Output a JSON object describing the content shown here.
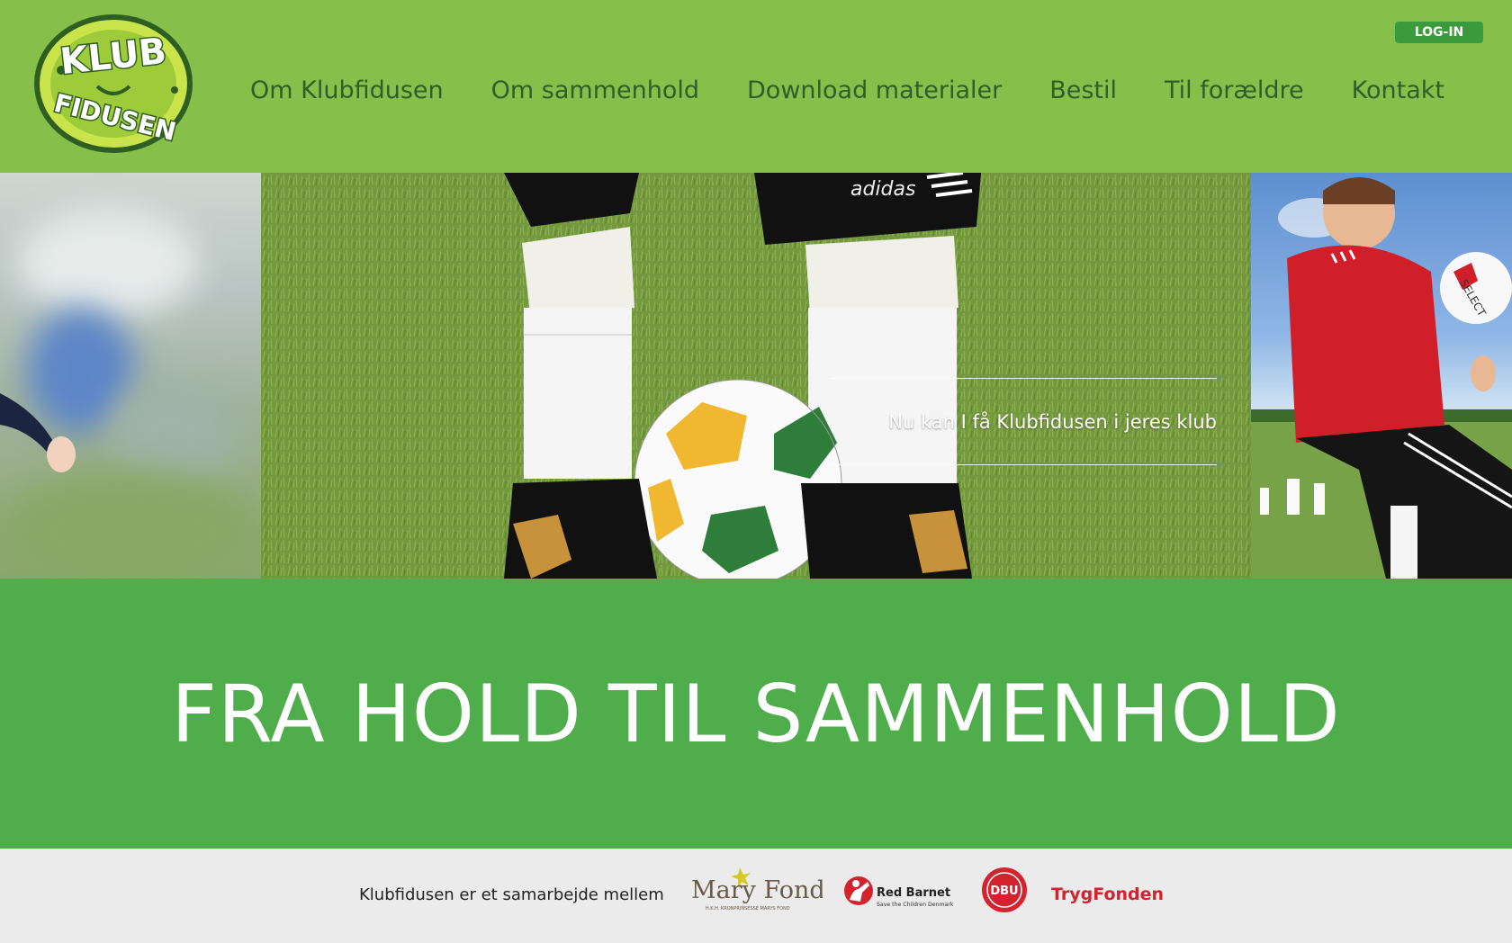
{
  "header": {
    "logo": {
      "line1": "KLUB",
      "line2": "FIDUSEN"
    },
    "login_label": "LOG-IN",
    "nav": [
      {
        "label": "Om Klubfidusen"
      },
      {
        "label": "Om sammenhold"
      },
      {
        "label": "Download materialer"
      },
      {
        "label": "Bestil"
      },
      {
        "label": "Til forældre"
      },
      {
        "label": "Kontakt"
      }
    ]
  },
  "hero": {
    "caption": "Nu kan I få Klubfidusen i jeres klub",
    "image_text": {
      "shorts_brand": "adidas",
      "ball_brand": "SELECT"
    }
  },
  "banner": {
    "title": "FRA HOLD TIL SAMMENHOLD"
  },
  "footer": {
    "text": "Klubfidusen er et samarbejde mellem",
    "partners": {
      "mary": {
        "name": "Mary Fonden",
        "sub": "H.K.H. KRONPRINSESSE MARYS FOND"
      },
      "redbarnet": {
        "name": "Red Barnet",
        "sub": "Save the Children Denmark"
      },
      "dbu": {
        "name": "DBU"
      },
      "tryg": {
        "name": "TrygFonden"
      }
    }
  },
  "colors": {
    "header_bg": "#86c04a",
    "nav_text": "#2f5e2b",
    "login_bg": "#3b9a3b",
    "banner_bg": "#4fad4b",
    "footer_bg": "#ebebeb",
    "red_brand": "#d3232f"
  }
}
